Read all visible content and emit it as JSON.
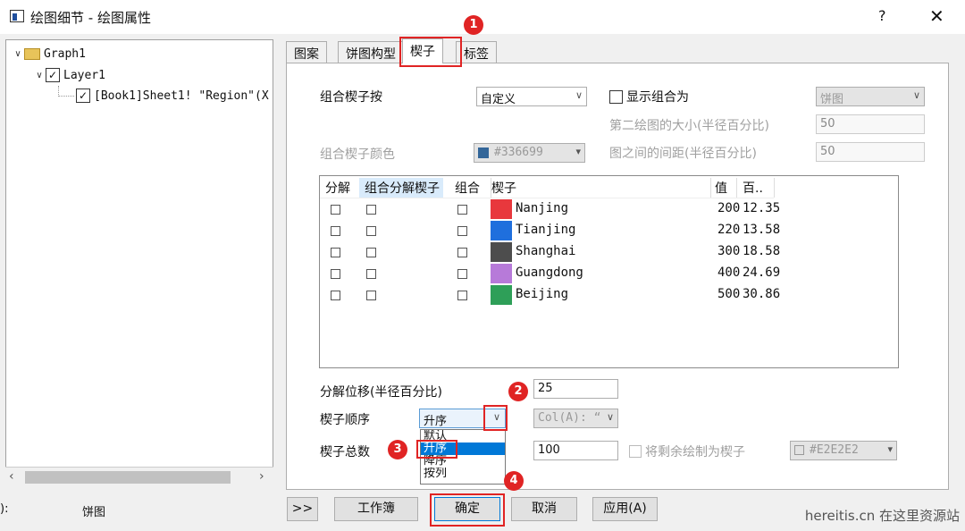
{
  "window": {
    "title": "绘图细节 - 绘图属性",
    "help": "?",
    "close": "✕"
  },
  "tree": {
    "graph": "Graph1",
    "layer": "Layer1",
    "plot": "[Book1]Sheet1! \"Region\"(X"
  },
  "bottom_left": {
    "label": "):",
    "value": "饼图"
  },
  "tabs": [
    "图案",
    "饼图构型",
    "楔子",
    "标签"
  ],
  "active_tab": "楔子",
  "panel": {
    "group_by_label": "组合楔子按",
    "group_by_value": "自定义",
    "show_group_label": "显示组合为",
    "show_group_value": "饼图",
    "second_size_label": "第二绘图的大小(半径百分比)",
    "second_size_value": "50",
    "group_color_label": "组合楔子颜色",
    "group_color_value": "#336699",
    "group_color_hex": "#336699",
    "spacing_label": "图之间的间距(半径百分比)",
    "spacing_value": "50",
    "explode_offset_label": "分解位移(半径百分比)",
    "explode_offset_value": "25",
    "order_label": "楔子顺序",
    "order_value": "升序",
    "order_col": "Col(A): “",
    "total_label": "楔子总数",
    "total_value": "100",
    "remaining_label": "将剩余绘制为楔子",
    "remaining_color": "#E2E2E2"
  },
  "grid": {
    "headers": [
      "分解",
      "组合分解楔子",
      "组合",
      "楔子",
      "值",
      "百.."
    ],
    "rows": [
      {
        "name": "Nanjing",
        "color": "#e8383d",
        "value": "200",
        "pct": "12.35"
      },
      {
        "name": "Tianjing",
        "color": "#1f6fdd",
        "value": "220",
        "pct": "13.58"
      },
      {
        "name": "Shanghai",
        "color": "#4d4d4d",
        "value": "300",
        "pct": "18.58"
      },
      {
        "name": "Guangdong",
        "color": "#b77ad9",
        "value": "400",
        "pct": "24.69"
      },
      {
        "name": "Beijing",
        "color": "#2e9f58",
        "value": "500",
        "pct": "30.86"
      }
    ]
  },
  "dropdown": {
    "items": [
      "默认",
      "升序",
      "降序",
      "按列"
    ],
    "selected": "升序"
  },
  "buttons": {
    "more": ">>",
    "workbook": "工作簿",
    "ok": "确定",
    "cancel": "取消",
    "apply": "应用(A)"
  },
  "badges": [
    "1",
    "2",
    "3",
    "4"
  ],
  "watermark": "hereitis.cn 在这里资源站",
  "colors": {
    "selection": "#0078d7",
    "annotation": "#e02424"
  }
}
